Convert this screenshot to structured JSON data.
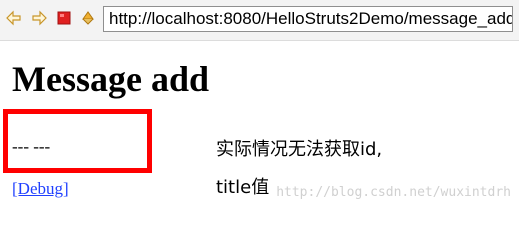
{
  "browser": {
    "url": "http://localhost:8080/HelloStruts2Demo/message_add",
    "icons": {
      "back": "back-arrow-icon",
      "forward": "forward-arrow-icon",
      "stop": "stop-icon",
      "refresh": "refresh-icon"
    },
    "colors": {
      "stop_red": "#e02020",
      "arrows": "#e8b040"
    }
  },
  "page": {
    "title": "Message add",
    "message_text": "--- ---",
    "debug_link": "[Debug]"
  },
  "annotation": {
    "line1": "实际情况无法获取id,",
    "line2": "title值",
    "box_color": "#ff0000"
  },
  "watermark": "http://blog.csdn.net/wuxintdrh"
}
